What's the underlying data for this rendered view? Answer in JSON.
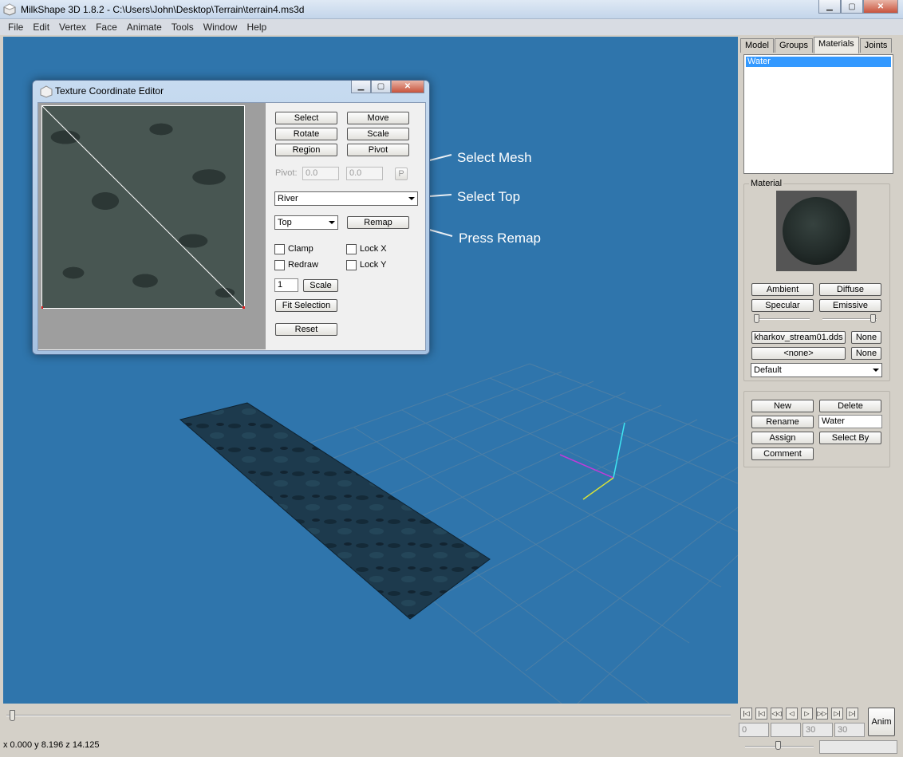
{
  "app": {
    "title": "MilkShape 3D 1.8.2 - C:\\Users\\John\\Desktop\\Terrain\\terrain4.ms3d",
    "window_buttons": {
      "minimize": "▁",
      "maximize": "▢",
      "close": "✕"
    }
  },
  "menu": [
    "File",
    "Edit",
    "Vertex",
    "Face",
    "Animate",
    "Tools",
    "Window",
    "Help"
  ],
  "panel": {
    "tabs": [
      "Model",
      "Groups",
      "Materials",
      "Joints"
    ],
    "active_tab": "Materials",
    "materials_list": [
      "Water"
    ],
    "material_group_label": "Material",
    "ambient": "Ambient",
    "diffuse": "Diffuse",
    "specular": "Specular",
    "emissive": "Emissive",
    "texture_file": "kharkov_stream01.dds",
    "alpha_file": "<none>",
    "none1": "None",
    "none2": "None",
    "mode": "Default",
    "new": "New",
    "delete": "Delete",
    "rename": "Rename",
    "rename_value": "Water",
    "assign": "Assign",
    "select_by": "Select By",
    "comment": "Comment"
  },
  "dialog": {
    "title": "Texture Coordinate Editor",
    "select": "Select",
    "move": "Move",
    "rotate": "Rotate",
    "scale": "Scale",
    "region": "Region",
    "pivot": "Pivot",
    "pivot_label": "Pivot:",
    "pivot_x": "0.0",
    "pivot_y": "0.0",
    "p_button": "P",
    "mesh": "River",
    "projection": "Top",
    "remap": "Remap",
    "clamp": "Clamp",
    "redraw": "Redraw",
    "lock_x": "Lock X",
    "lock_y": "Lock Y",
    "scale_value": "1",
    "scale_btn": "Scale",
    "fit_selection": "Fit Selection",
    "reset": "Reset"
  },
  "callouts": {
    "select_mesh": "Select Mesh",
    "select_top": "Select Top",
    "press_remap": "Press Remap"
  },
  "timeline": {
    "frame": "0",
    "f2": "",
    "f3": "30",
    "f4": "30",
    "anim": "Anim",
    "nav": [
      "|◁",
      "|◁",
      "◁◁",
      "◁",
      "▷",
      "▷▷",
      "▷|",
      "▷|"
    ]
  },
  "status": "x 0.000 y 8.196 z 14.125",
  "colors": {
    "viewport": "#2f75ac",
    "selection": "#3399ff"
  }
}
